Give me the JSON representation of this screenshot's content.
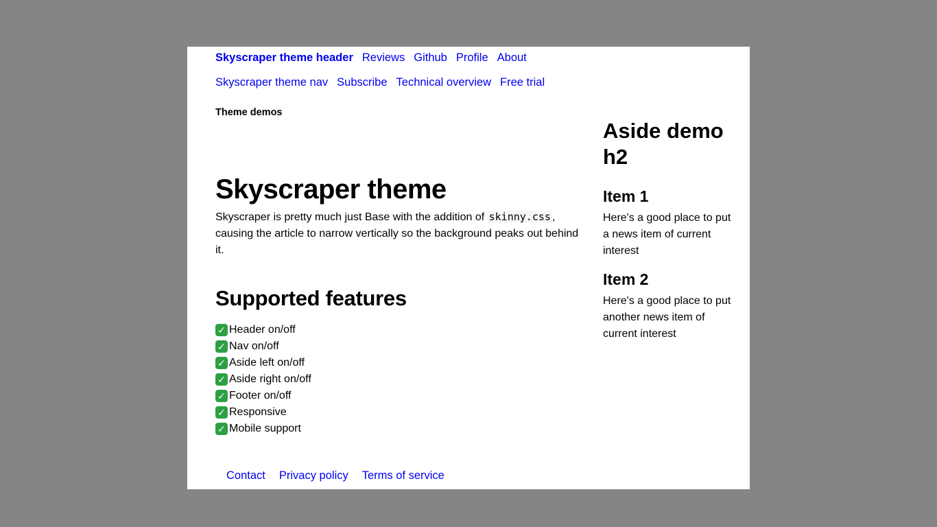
{
  "header": {
    "brand": "Skyscraper theme header",
    "links": [
      "Reviews",
      "Github",
      "Profile",
      "About"
    ]
  },
  "nav": {
    "links": [
      "Skyscraper theme nav",
      "Subscribe",
      "Technical overview",
      "Free trial"
    ]
  },
  "aside_left": {
    "title": "Theme demos"
  },
  "main": {
    "title": "Skyscraper theme",
    "intro_before": "Skyscraper is pretty much just Base with the addition of ",
    "intro_code": "skinny.css",
    "intro_after": ", causing the article to narrow vertically so the background peaks out behind it.",
    "features_title": "Supported features",
    "features": [
      "Header on/off",
      "Nav on/off",
      "Aside left on/off",
      "Aside right on/off",
      "Footer on/off",
      "Responsive",
      "Mobile support"
    ]
  },
  "aside_right": {
    "title": "Aside demo h2",
    "items": [
      {
        "title": "Item 1",
        "text": "Here's a good place to put a news item of current interest"
      },
      {
        "title": "Item 2",
        "text": "Here's a good place to put another news item of current interest"
      }
    ]
  },
  "footer": {
    "links": [
      "Contact",
      "Privacy policy",
      "Terms of service"
    ]
  },
  "colors": {
    "link": "#0000ee",
    "backdrop": "#858585",
    "check": "#2ea043"
  },
  "icons": {
    "feature_check": "white-heavy-check-mark-icon"
  }
}
